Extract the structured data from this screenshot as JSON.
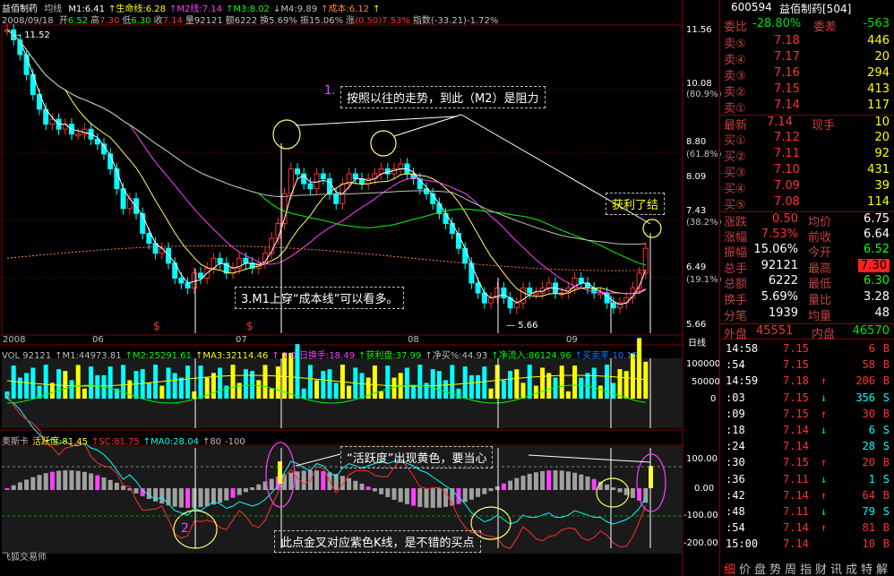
{
  "header": {
    "title": "益佰制药",
    "mode": "均线",
    "ma_items": [
      {
        "text": "M1:6.41",
        "color": "#ffffff"
      },
      {
        "text": "↑生命线:6.28",
        "color": "#ffff00"
      },
      {
        "text": "↑M2线:7.14",
        "color": "#ff40ff"
      },
      {
        "text": "↑M3:8.02",
        "color": "#00ff00"
      },
      {
        "text": "↓M4:9.89",
        "color": "#c0c0c0"
      },
      {
        "text": "↑成本:6.12",
        "color": "#ff8040"
      },
      {
        "text": "↑",
        "color": "#ffff00"
      }
    ],
    "date": "2008/09/18",
    "quote_items": [
      {
        "label": "开",
        "value": "6.52",
        "color": "#00ff00"
      },
      {
        "label": "高",
        "value": "7.30",
        "color": "#ff3030"
      },
      {
        "label": "低",
        "value": "6.30",
        "color": "#00ff00"
      },
      {
        "label": "收",
        "value": "7.14",
        "color": "#ff3030"
      },
      {
        "label": "量",
        "value": "92121",
        "color": "#c0c0c0"
      },
      {
        "label": "额",
        "value": "6222",
        "color": "#c0c0c0"
      },
      {
        "label": "换",
        "value": "5.69%",
        "color": "#c0c0c0"
      },
      {
        "label": "振",
        "value": "15.06%",
        "color": "#c0c0c0"
      },
      {
        "label": "涨",
        "value": "(0.50)7.53%",
        "color": "#ff3030"
      },
      {
        "label": "指数",
        "value": "(-33.21)-1.72%",
        "color": "#c0c0c0"
      }
    ]
  },
  "price_axis": [
    "11.56",
    "10.08",
    "(80.9%)",
    "8.80",
    "(61.8%)",
    "8.09",
    "7.43",
    "(38.2%)",
    "6.49",
    "(19.1%)",
    "5.66"
  ],
  "price_markers": {
    "high": "11.52",
    "low": "5.66"
  },
  "date_axis": [
    "2008",
    "06",
    "07",
    "08",
    "09"
  ],
  "period_label": "日线",
  "annotations": {
    "note1_num": "1.",
    "note1": "按照以往的走势，到此（M2）是阻力",
    "note_profit": "获利了结",
    "note3": "3.M1上穿“成本线”可以看多。",
    "note_active": "“活跃度”出现黄色，要当心",
    "note2_num": "2",
    "note_buy": "此点金叉对应紫色K线，是不错的买点"
  },
  "vol_header": [
    {
      "text": "VOL 92121",
      "color": "#c0c0c0"
    },
    {
      "text": "↑M1:44973.81",
      "color": "#c0c0c0"
    },
    {
      "text": "↑M2:25291.61",
      "color": "#00ff00"
    },
    {
      "text": "↑MA3:32114.46",
      "color": "#ffff00"
    },
    {
      "text": "↑ 1 0 日换手:18.49",
      "color": "#ff40ff"
    },
    {
      "text": "↑获利盘:37.99",
      "color": "#00ff00"
    },
    {
      "text": "↑净买%:44.93",
      "color": "#c0c0c0"
    },
    {
      "text": "↑净流入:86124.96",
      "color": "#00ff00"
    },
    {
      "text": "↑买卖率:10.15",
      "color": "#0080ff"
    }
  ],
  "vol_axis": [
    "100000",
    "50000",
    "0"
  ],
  "osc_header": [
    {
      "text": "奥斯卡",
      "color": "#c0c0c0"
    },
    {
      "text": "活跃度:81.45",
      "color": "#ffff00"
    },
    {
      "text": "↑SC:81.75",
      "color": "#ff3030"
    },
    {
      "text": "↑MA0:28.04",
      "color": "#00ffff"
    },
    {
      "text": "↑80",
      "color": "#c0c0c0"
    },
    {
      "text": "-100",
      "color": "#c0c0c0"
    }
  ],
  "osc_axis": [
    "100.00",
    "0.00",
    "-100.00",
    "-200.00"
  ],
  "watermark": "飞狐交易师",
  "panel": {
    "code": "600594",
    "name": "益佰制药[504]",
    "weibi_label": "委比",
    "weibi_value": "-28.80%",
    "weicha_label": "委差",
    "weicha_value": "-563",
    "asks": [
      {
        "label": "卖⑤",
        "price": "7.18",
        "vol": "446"
      },
      {
        "label": "卖④",
        "price": "7.17",
        "vol": "20"
      },
      {
        "label": "卖③",
        "price": "7.16",
        "vol": "294"
      },
      {
        "label": "卖②",
        "price": "7.15",
        "vol": "413"
      },
      {
        "label": "卖①",
        "price": "7.14",
        "vol": "117"
      }
    ],
    "latest": {
      "label": "最新",
      "price": "7.14",
      "label2": "现手",
      "vol": "10"
    },
    "bids": [
      {
        "label": "买①",
        "price": "7.12",
        "vol": "20"
      },
      {
        "label": "买②",
        "price": "7.11",
        "vol": "92"
      },
      {
        "label": "买③",
        "price": "7.10",
        "vol": "431"
      },
      {
        "label": "买④",
        "price": "7.09",
        "vol": "39"
      },
      {
        "label": "买⑤",
        "price": "7.08",
        "vol": "114"
      }
    ],
    "stats": [
      {
        "l1": "涨跌",
        "v1": "0.50",
        "c1": "#ff3030",
        "l2": "均价",
        "v2": "6.75",
        "c2": "#ffffff"
      },
      {
        "l1": "涨幅",
        "v1": "7.53%",
        "c1": "#ff3030",
        "l2": "前收",
        "v2": "6.64",
        "c2": "#ffffff"
      },
      {
        "l1": "振幅",
        "v1": "15.06%",
        "c1": "#ffffff",
        "l2": "今开",
        "v2": "6.52",
        "c2": "#00ff00"
      },
      {
        "l1": "总手",
        "v1": "92121",
        "c1": "#ffffff",
        "l2": "最高",
        "v2": "7.30",
        "c2": "#ffffff"
      },
      {
        "l1": "总额",
        "v1": "6222",
        "c1": "#ffffff",
        "l2": "最低",
        "v2": "6.30",
        "c2": "#00ff00"
      },
      {
        "l1": "换手",
        "v1": "5.69%",
        "c1": "#ffffff",
        "l2": "量比",
        "v2": "3.28",
        "c2": "#ffffff"
      },
      {
        "l1": "分笔",
        "v1": "1939",
        "c1": "#ffffff",
        "l2": "均量",
        "v2": "48",
        "c2": "#ffffff"
      }
    ],
    "waipan_label": "外盘",
    "waipan_value": "45551",
    "neipan_label": "内盘",
    "neipan_value": "46570",
    "ticks": [
      {
        "time": "14:58",
        "price": "7.15",
        "arrow": "",
        "vol": "6",
        "side": "B"
      },
      {
        "time": ":54",
        "price": "7.15",
        "arrow": "",
        "vol": "58",
        "side": "B"
      },
      {
        "time": "14:59",
        "price": "7.18",
        "arrow": "↑",
        "vol": "206",
        "side": "B"
      },
      {
        "time": ":03",
        "price": "7.15",
        "arrow": "↓",
        "vol": "356",
        "side": "S"
      },
      {
        "time": ":09",
        "price": "7.15",
        "arrow": "↑",
        "vol": "30",
        "side": "B"
      },
      {
        "time": ":18",
        "price": "7.14",
        "arrow": "↓",
        "vol": "6",
        "side": "S"
      },
      {
        "time": ":24",
        "price": "7.14",
        "arrow": "",
        "vol": "28",
        "side": "S"
      },
      {
        "time": ":30",
        "price": "7.15",
        "arrow": "↑",
        "vol": "20",
        "side": "B"
      },
      {
        "time": ":36",
        "price": "7.11",
        "arrow": "↓",
        "vol": "1",
        "side": "S"
      },
      {
        "time": ":42",
        "price": "7.14",
        "arrow": "↑",
        "vol": "64",
        "side": "B"
      },
      {
        "time": ":48",
        "price": "7.11",
        "arrow": "↓",
        "vol": "79",
        "side": "S"
      },
      {
        "time": ":54",
        "price": "7.14",
        "arrow": "↑",
        "vol": "81",
        "side": "B"
      },
      {
        "time": "15:00",
        "price": "7.14",
        "arrow": "",
        "vol": "10",
        "side": "B"
      }
    ],
    "bottom_tabs": [
      "细",
      "价",
      "盘",
      "势",
      "周",
      "指",
      "财",
      "讯",
      "成",
      "特",
      "解"
    ]
  }
}
